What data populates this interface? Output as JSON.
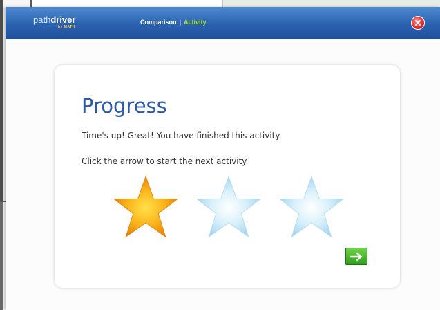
{
  "app": {
    "logo": {
      "path": "path",
      "driver": "driver",
      "tagline": "by MATH"
    },
    "breadcrumb": {
      "section": "Comparison",
      "separator": "|",
      "current": "Activity"
    },
    "close_icon": "close-icon"
  },
  "progress": {
    "title": "Progress",
    "message": "Time's up! Great! You have finished this activity.",
    "instruction": "Click the arrow to start the next activity.",
    "stars_earned": 1,
    "stars_total": 3,
    "next_icon": "arrow-right-icon"
  },
  "colors": {
    "titlebar": "#2a62b0",
    "title_text": "#2c5aa8",
    "current_crumb": "#a9e23b",
    "star_earned": "#f6a10f",
    "star_empty": "#bfe3f5",
    "next_button": "#3fae2a",
    "close_button": "#e12727"
  }
}
